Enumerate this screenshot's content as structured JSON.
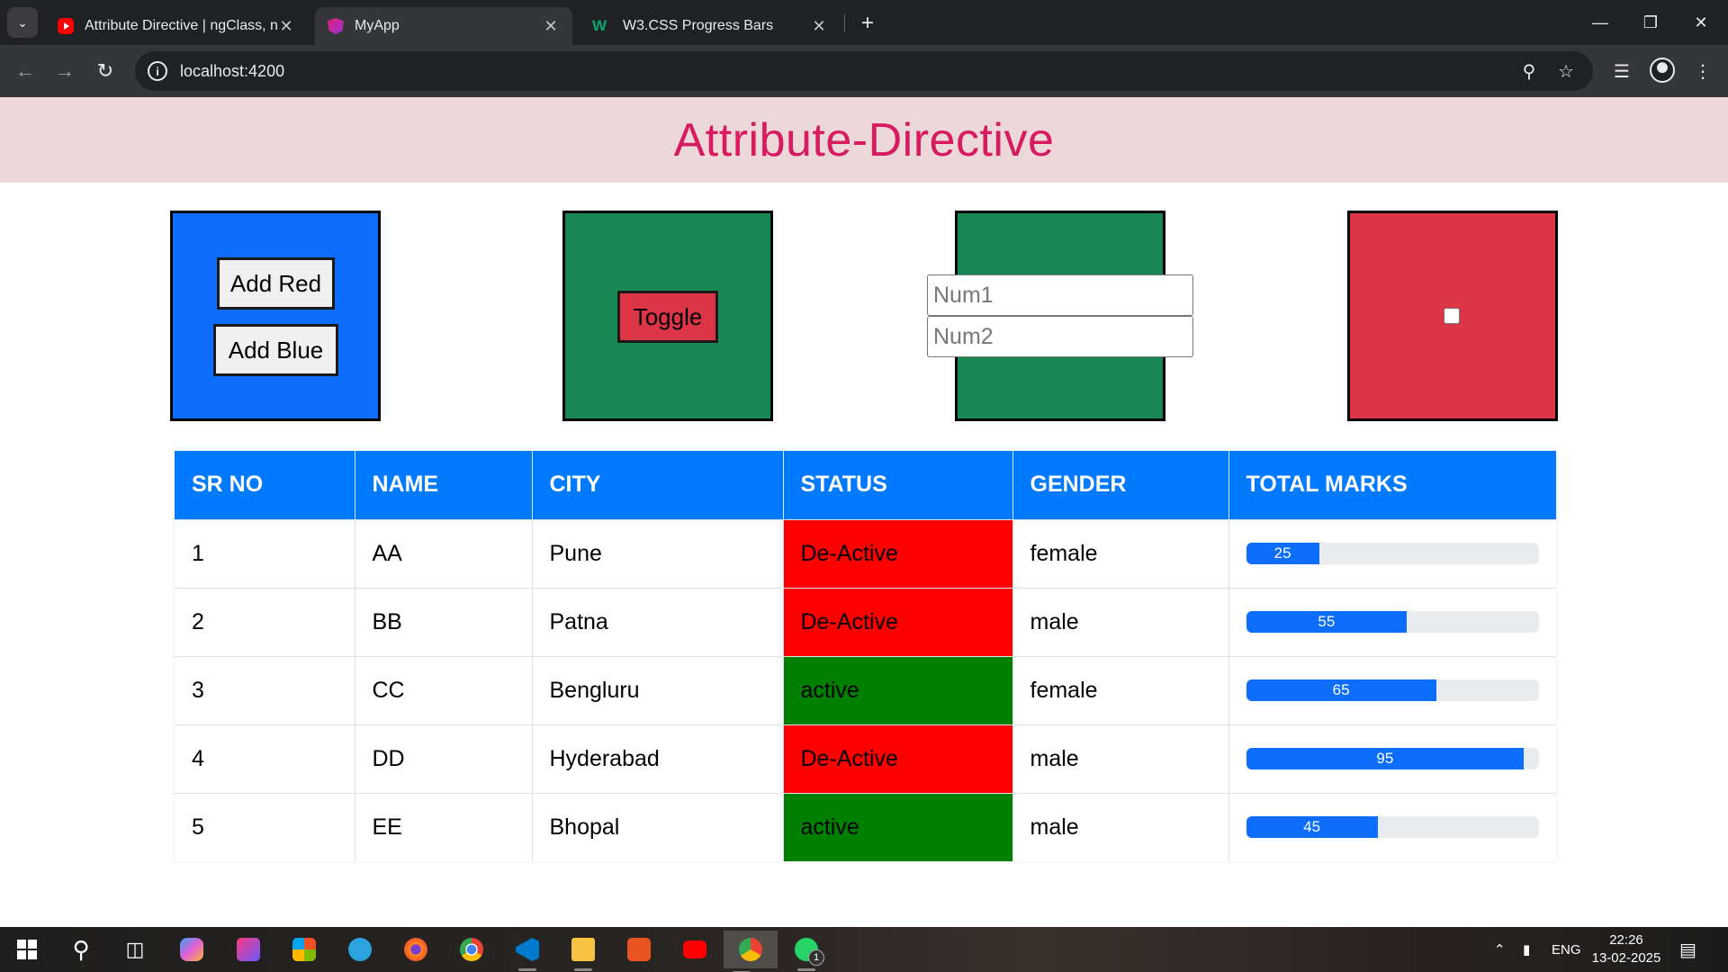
{
  "browser": {
    "tabs": [
      {
        "title": "Attribute Directive | ngClass, ng",
        "favicon": "youtube-icon"
      },
      {
        "title": "MyApp",
        "favicon": "angular-icon"
      },
      {
        "title": "W3.CSS Progress Bars",
        "favicon": "w3schools-icon"
      }
    ],
    "url": "localhost:4200"
  },
  "page": {
    "title": "Attribute-Directive",
    "box1": {
      "add_red_label": "Add Red",
      "add_blue_label": "Add Blue",
      "color": "#0d6efd"
    },
    "box2": {
      "toggle_label": "Toggle",
      "color": "#198754"
    },
    "box3": {
      "num1_placeholder": "Num1",
      "num2_placeholder": "Num2",
      "color": "#198754"
    },
    "box4": {
      "checked": false,
      "color": "#dc3545"
    }
  },
  "table": {
    "headers": [
      "SR NO",
      "NAME",
      "CITY",
      "STATUS",
      "GENDER",
      "TOTAL MARKS"
    ],
    "rows": [
      {
        "sr": "1",
        "name": "AA",
        "city": "Pune",
        "status": "De-Active",
        "gender": "female",
        "marks": "25"
      },
      {
        "sr": "2",
        "name": "BB",
        "city": "Patna",
        "status": "De-Active",
        "gender": "male",
        "marks": "55"
      },
      {
        "sr": "3",
        "name": "CC",
        "city": "Bengluru",
        "status": "active",
        "gender": "female",
        "marks": "65"
      },
      {
        "sr": "4",
        "name": "DD",
        "city": "Hyderabad",
        "status": "De-Active",
        "gender": "male",
        "marks": "95"
      },
      {
        "sr": "5",
        "name": "EE",
        "city": "Bhopal",
        "status": "active",
        "gender": "male",
        "marks": "45"
      }
    ],
    "status_colors": {
      "De-Active": "#ff0000",
      "active": "#008000"
    },
    "progress_color": "#0d6efd"
  },
  "taskbar": {
    "language": "ENG",
    "time": "22:26",
    "date": "13-02-2025",
    "whatsapp_badge": "1"
  }
}
